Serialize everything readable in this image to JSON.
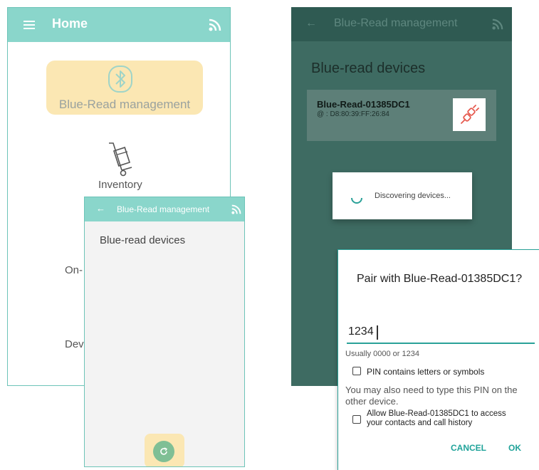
{
  "home": {
    "title": "Home",
    "items": [
      {
        "label": "Blue-Read management"
      },
      {
        "label": "Inventory"
      },
      {
        "label": "On-"
      },
      {
        "label": "Dev"
      }
    ],
    "colors": {
      "bar": "#8ad6cb",
      "highlight": "#fbe7b3"
    }
  },
  "mgmt": {
    "title": "Blue-Read management",
    "heading": "Blue-read devices"
  },
  "dark": {
    "title": "Blue-Read management",
    "heading": "Blue-read devices",
    "device": {
      "name": "Blue-Read-01385DC1",
      "mac": "@ : D8:80:39:FF:26:84"
    },
    "discovering": "Discovering devices..."
  },
  "pair": {
    "title": "Pair with Blue-Read-01385DC1?",
    "pin": "1234",
    "hint": "Usually 0000 or 1234",
    "checkbox_letters": "PIN contains letters or symbols",
    "note": "You may also need to type this PIN on the other device.",
    "checkbox_allow": "Allow Blue-Read-01385DC1 to access your contacts and call history",
    "cancel": "CANCEL",
    "ok": "OK"
  }
}
